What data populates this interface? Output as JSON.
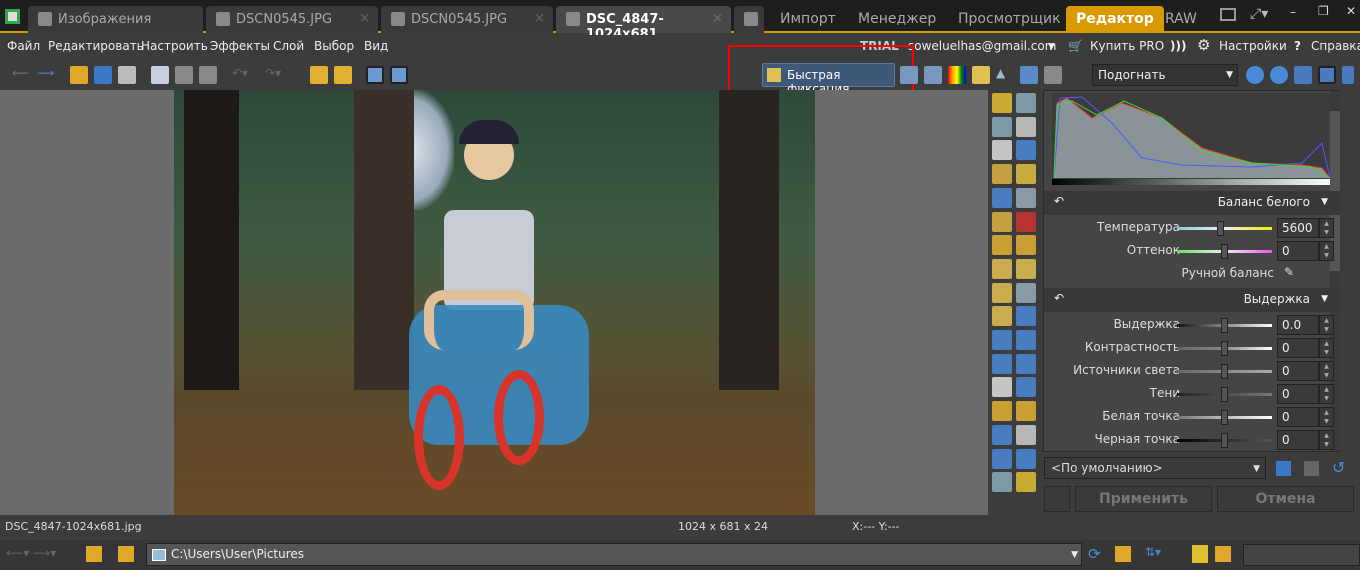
{
  "app_icon": "app-logo-icon",
  "tabs": [
    {
      "label": "Изображения",
      "icon": "folder-icon"
    },
    {
      "label": "DSCN0545.JPG",
      "icon": "edit-icon",
      "close": "×"
    },
    {
      "label": "DSCN0545.JPG",
      "icon": "edit-icon",
      "close": "×"
    },
    {
      "label": "DSC_4847-1024x681....",
      "icon": "edit-icon",
      "close": "×",
      "active": true
    }
  ],
  "modes": [
    "Импорт",
    "Менеджер",
    "Просмотрщик",
    "Редактор",
    "RAW"
  ],
  "active_mode": "Редактор",
  "window_controls": {
    "minimize": "–",
    "restore": "❐",
    "close": "✕"
  },
  "menu": [
    "Файл",
    "Редактировать",
    "Настроить",
    "Эффекты",
    "Слой",
    "Выбор",
    "Вид"
  ],
  "account": {
    "trial": "TRIAL",
    "email": "soweluelhas@gmail.com",
    "buy": "Купить PRO",
    "settings": "Настройки",
    "help": "Справка"
  },
  "toolbar": {
    "quick_fix": "Быстрая фиксация",
    "zoom_select": "Подогнать"
  },
  "accent": "#d89a00",
  "highlight_box_color": "#ff0000",
  "panel": {
    "white_balance": {
      "title": "Баланс белого",
      "temperature_label": "Температура",
      "temperature": "5600",
      "tint_label": "Оттенок",
      "tint": "0",
      "manual": "Ручной баланс"
    },
    "exposure": {
      "title": "Выдержка",
      "rows": [
        {
          "label": "Выдержка",
          "value": "0.0"
        },
        {
          "label": "Контрастность",
          "value": "0"
        },
        {
          "label": "Источники света",
          "value": "0"
        },
        {
          "label": "Тени",
          "value": "0"
        },
        {
          "label": "Белая точка",
          "value": "0"
        },
        {
          "label": "Черная точка",
          "value": "0"
        }
      ]
    },
    "preset": "<По умолчанию>",
    "apply": "Применить",
    "cancel": "Отмена"
  },
  "status": {
    "filename": "DSC_4847-1024x681.jpg",
    "dimensions": "1024 x 681 x 24",
    "coords": "X:---  Y:---"
  },
  "bottom": {
    "path": "C:\\Users\\User\\Pictures",
    "search_placeholder": ""
  }
}
